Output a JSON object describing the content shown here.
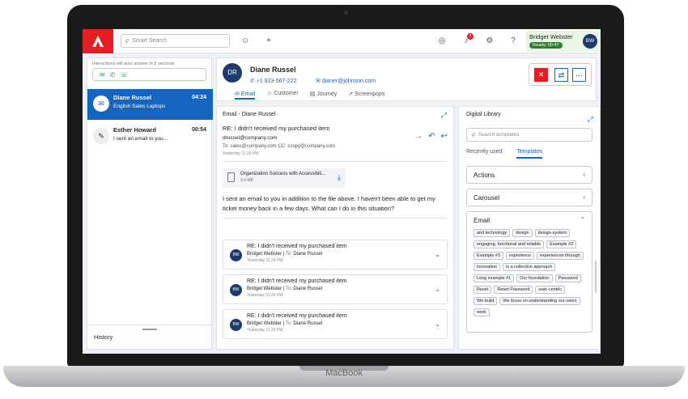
{
  "device": {
    "brand": "MacBook"
  },
  "topbar": {
    "logo_icon": "brand-a-logo",
    "search_placeholder": "Smart Search",
    "notification_count": "3",
    "user_name": "Bridget Webster",
    "user_status": "Ready: 00:47",
    "user_initials": "BW"
  },
  "left": {
    "hint": "Interactions will auto answer in 5 seconds",
    "conversations": [
      {
        "name": "Diane Russel",
        "sub": "English Sales Laptops",
        "time": "04:24"
      },
      {
        "name": "Esther Howard",
        "sub": "I sent an email to you...",
        "time": "00:54"
      }
    ],
    "history_label": "History"
  },
  "contact": {
    "initials": "DR",
    "name": "Diane Russel",
    "phone": "+1 923-567-222",
    "email": "dianer@johnson.com",
    "tabs": [
      "Email",
      "Customer",
      "Journey",
      "Screenpops"
    ]
  },
  "email": {
    "title": "Email - Diane Russel",
    "subject": "RE: I didn't received my purchased item",
    "from": "drussel@company.com",
    "to": "To: sales@company.com   CC: ccopy@company.com",
    "date": "Yesterday 11.29 PM",
    "attachment": {
      "name": "Organization Success with Accessibili...",
      "size": "3.4 MB"
    },
    "body": "I sent an email to you in addition to the file above. I haven't been able to get my ticket money back in a few days. What can I do in this situation?",
    "threads": [
      {
        "initials": "BW",
        "subject": "RE: I didn't received my purchased item",
        "from": "Bridget Webster",
        "to_label": "To:",
        "to": "Diane Russel",
        "date": "Yesterday 11.29 PM"
      },
      {
        "initials": "BW",
        "subject": "RE: I didn't received my purchased item",
        "from": "Bridget Webster",
        "to_label": "To:",
        "to": "Diane Russel",
        "date": "Yesterday 11.29 PM"
      },
      {
        "initials": "BW",
        "subject": "RE: I didn't received my purchased item",
        "from": "Bridget Webster",
        "to_label": "To:",
        "to": "Diane Russel",
        "date": "Yesterday 11.29 PM"
      }
    ]
  },
  "library": {
    "title": "Digital Library",
    "search_placeholder": "Search templates",
    "tabs": [
      "Recently used",
      "Templates"
    ],
    "sections": [
      "Actions",
      "Carousel"
    ],
    "email_section": "Email",
    "chips": [
      "and technology",
      "design",
      "design-system",
      "engaging, functional and reliable",
      "Example #2",
      "Example #3",
      "experience",
      "experiences through",
      "innovation",
      "is a collective approach",
      "Long example #1",
      "Our foundation",
      "Password",
      "Reset",
      "Reset Password",
      "user-centric",
      "We build",
      "We focus on understanding our users",
      "work"
    ]
  },
  "colors": {
    "accent": "#1565c0",
    "brand": "#e31e25",
    "ready": "#2e7d32"
  }
}
